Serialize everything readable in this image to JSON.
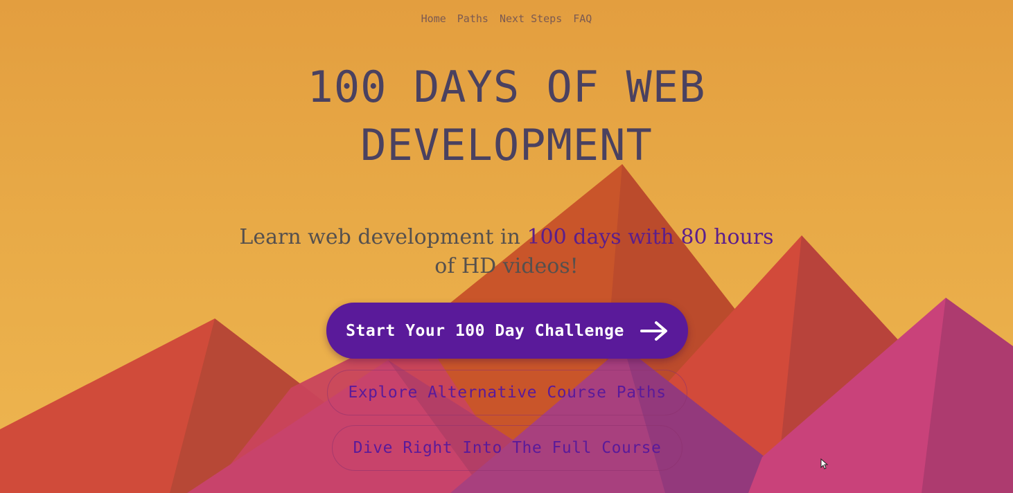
{
  "nav": {
    "items": [
      {
        "label": "Home"
      },
      {
        "label": "Paths"
      },
      {
        "label": "Next Steps"
      },
      {
        "label": "FAQ"
      }
    ]
  },
  "hero": {
    "title_line1": "100 DAYS OF WEB",
    "title_line2": "DEVELOPMENT",
    "subtitle": {
      "part1": "Learn web development in ",
      "highlight1": "100 days",
      "part2": " with ",
      "highlight2": "80 hours",
      "part3": " of HD videos!"
    }
  },
  "buttons": {
    "primary_label": "Start Your 100 Day Challenge",
    "primary_icon": "arrow-right-icon",
    "explore_label": "Explore Alternative Course Paths",
    "dive_label": "Dive Right Into The Full Course"
  },
  "colors": {
    "accent": "#5a1a9a",
    "title": "#4a4160",
    "highlight": "#5b1e8c"
  }
}
